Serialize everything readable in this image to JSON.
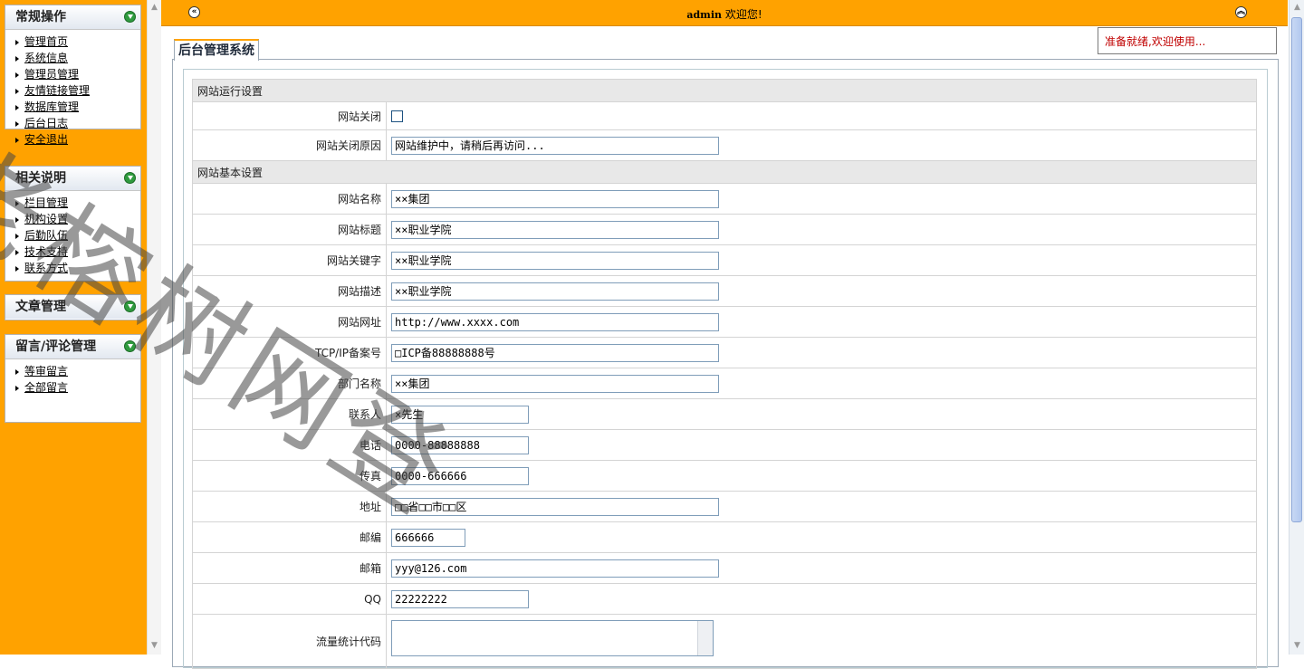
{
  "sidebar": {
    "panels": [
      {
        "title": "常规操作",
        "items": [
          "管理首页",
          "系统信息",
          "管理员管理",
          "友情链接管理",
          "数据库管理",
          "后台日志",
          "安全退出"
        ]
      },
      {
        "title": "相关说明",
        "items": [
          "栏目管理",
          "机构设置",
          "后勤队伍",
          "技术支持",
          "联系方式"
        ]
      },
      {
        "title": "文章管理",
        "items": []
      },
      {
        "title": "留言/评论管理",
        "items": [
          "等审留言",
          "全部留言"
        ]
      }
    ]
  },
  "topbar": {
    "user": "admin",
    "welcome": "欢迎您!"
  },
  "notice": "准备就绪,欢迎使用...",
  "tab_title": "后台管理系统",
  "form": {
    "section_run": "网站运行设置",
    "site_close_label": "网站关闭",
    "site_close_checked": false,
    "close_reason_label": "网站关闭原因",
    "close_reason_value": "网站维护中，请稍后再访问...",
    "section_basic": "网站基本设置",
    "site_name_label": "网站名称",
    "site_name_value": "××集团",
    "site_title_label": "网站标题",
    "site_title_value": "××职业学院",
    "site_keywords_label": "网站关键字",
    "site_keywords_value": "××职业学院",
    "site_desc_label": "网站描述",
    "site_desc_value": "××职业学院",
    "site_url_label": "网站网址",
    "site_url_value": "http://www.xxxx.com",
    "icp_label": "TCP/IP备案号",
    "icp_value": "□ICP备88888888号",
    "dept_label": "部门名称",
    "dept_value": "××集团",
    "contact_label": "联系人",
    "contact_value": "×先生",
    "phone_label": "电话",
    "phone_value": "0000-88888888",
    "fax_label": "传真",
    "fax_value": "0000-666666",
    "address_label": "地址",
    "address_value": "□□省□□市□□区",
    "zip_label": "邮编",
    "zip_value": "666666",
    "email_label": "邮箱",
    "email_value": "yyy@126.com",
    "qq_label": "QQ",
    "qq_value": "22222222",
    "stats_label": "流量统计代码",
    "stats_value": ""
  },
  "watermark": "老榕树网登",
  "colors": {
    "accent": "#ffa200",
    "notice_text": "#c00000"
  }
}
